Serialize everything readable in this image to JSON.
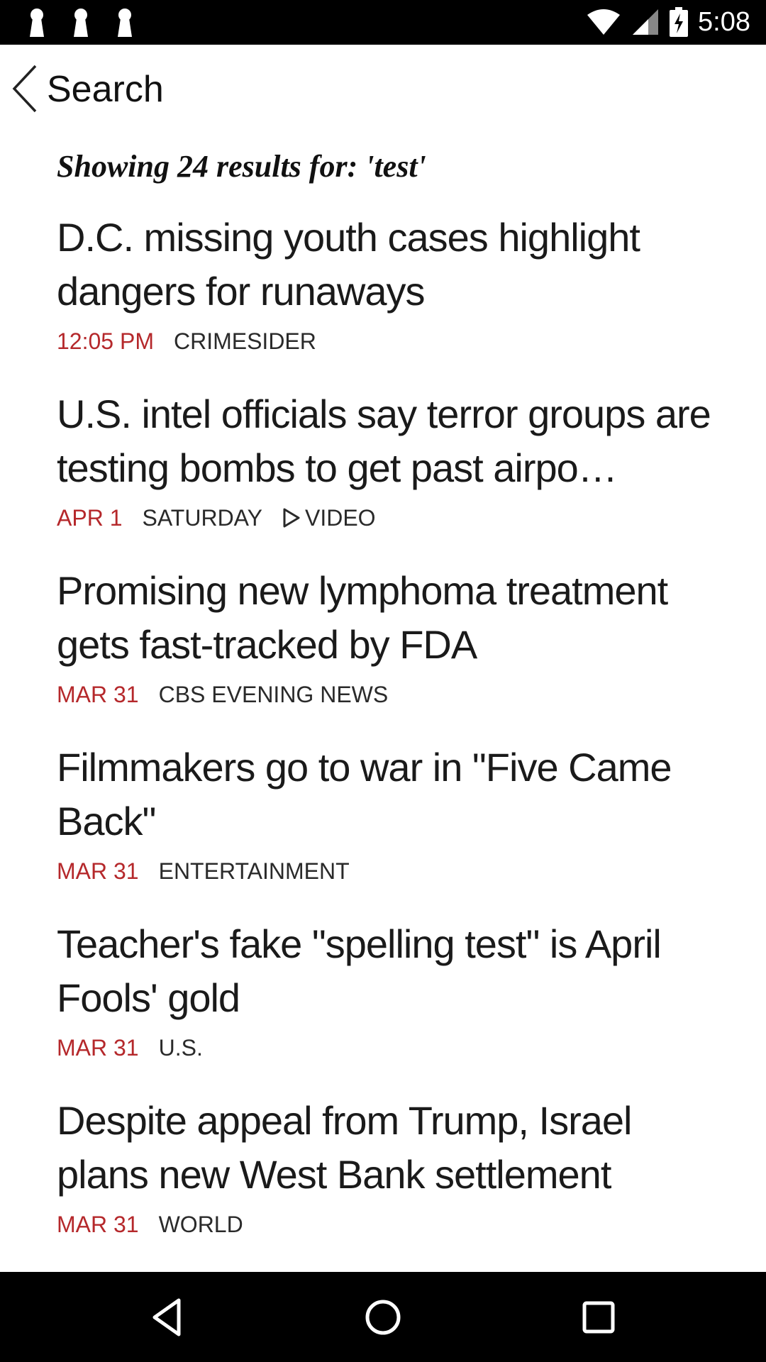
{
  "status_bar": {
    "time": "5:08",
    "left_icons": [
      "keyhole-icon",
      "keyhole-icon",
      "keyhole-icon"
    ],
    "right_icons": [
      "wifi-icon",
      "cell-signal-icon",
      "battery-charging-icon"
    ]
  },
  "app_bar": {
    "back_icon": "chevron-left-icon",
    "title": "Search"
  },
  "search": {
    "summary": "Showing 24 results for: 'test'"
  },
  "results": [
    {
      "headline": "D.C. missing youth cases highlight dangers for runaways",
      "date": "12:05 PM",
      "category": "CRIMESIDER",
      "video": ""
    },
    {
      "headline": "U.S. intel officials say terror groups are testing bombs to get past airpo…",
      "date": "APR 1",
      "category": "SATURDAY",
      "video": "VIDEO"
    },
    {
      "headline": "Promising new lymphoma treatment gets fast-tracked by FDA",
      "date": "MAR 31",
      "category": "CBS EVENING NEWS",
      "video": ""
    },
    {
      "headline": "Filmmakers go to war in \"Five Came Back\"",
      "date": "MAR 31",
      "category": "ENTERTAINMENT",
      "video": ""
    },
    {
      "headline": "Teacher's fake \"spelling test\" is April Fools' gold",
      "date": "MAR 31",
      "category": "U.S.",
      "video": ""
    },
    {
      "headline": "Despite appeal from Trump, Israel plans new West Bank settlement",
      "date": "MAR 31",
      "category": "WORLD",
      "video": ""
    }
  ],
  "nav_bar": {
    "icons": [
      "nav-back-icon",
      "nav-home-icon",
      "nav-recents-icon"
    ]
  },
  "colors": {
    "date_accent": "#b5282b",
    "text": "#1a1a1a",
    "system_bars": "#000000"
  }
}
